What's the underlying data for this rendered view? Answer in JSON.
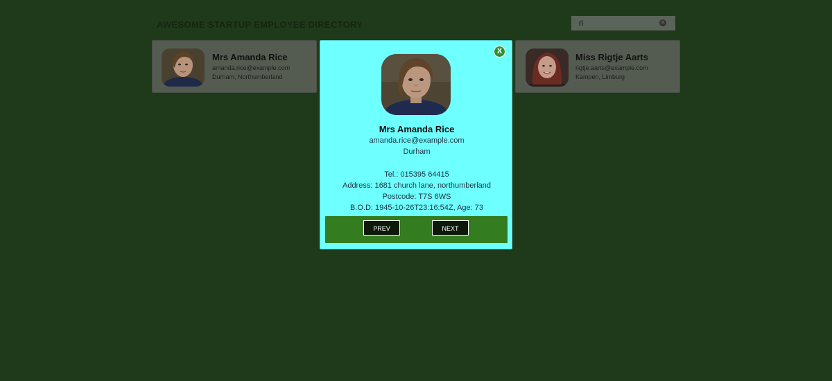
{
  "header": {
    "title": "Awesome Startup Employee Directory"
  },
  "search": {
    "value": "ri",
    "clear_icon": "clear-icon"
  },
  "cards": [
    {
      "name": "Mrs Amanda Rice",
      "email": "amanda.rice@example.com",
      "location": "Durham, Northumberland"
    },
    {
      "name": "Miss Rigtje Aarts",
      "email": "rigtje.aarts@example.com",
      "location": "Kampen, Limburg"
    }
  ],
  "modal": {
    "close_label": "X",
    "name": "Mrs Amanda Rice",
    "email": "amanda.rice@example.com",
    "city": "Durham",
    "phone": "Tel.: 015395 64415",
    "address": "Address: 1681 church lane, northumberland",
    "postcode": "Postcode: T7S 6WS",
    "dob": "B.O.D: 1945-10-26T23:16:54Z, Age: 73",
    "prev_label": "PREV",
    "next_label": "NEXT"
  },
  "colors": {
    "background": "#1f3a1b",
    "modal_background": "#6effff",
    "nav_bar": "#347c20",
    "close_button": "#2f8f3a"
  }
}
